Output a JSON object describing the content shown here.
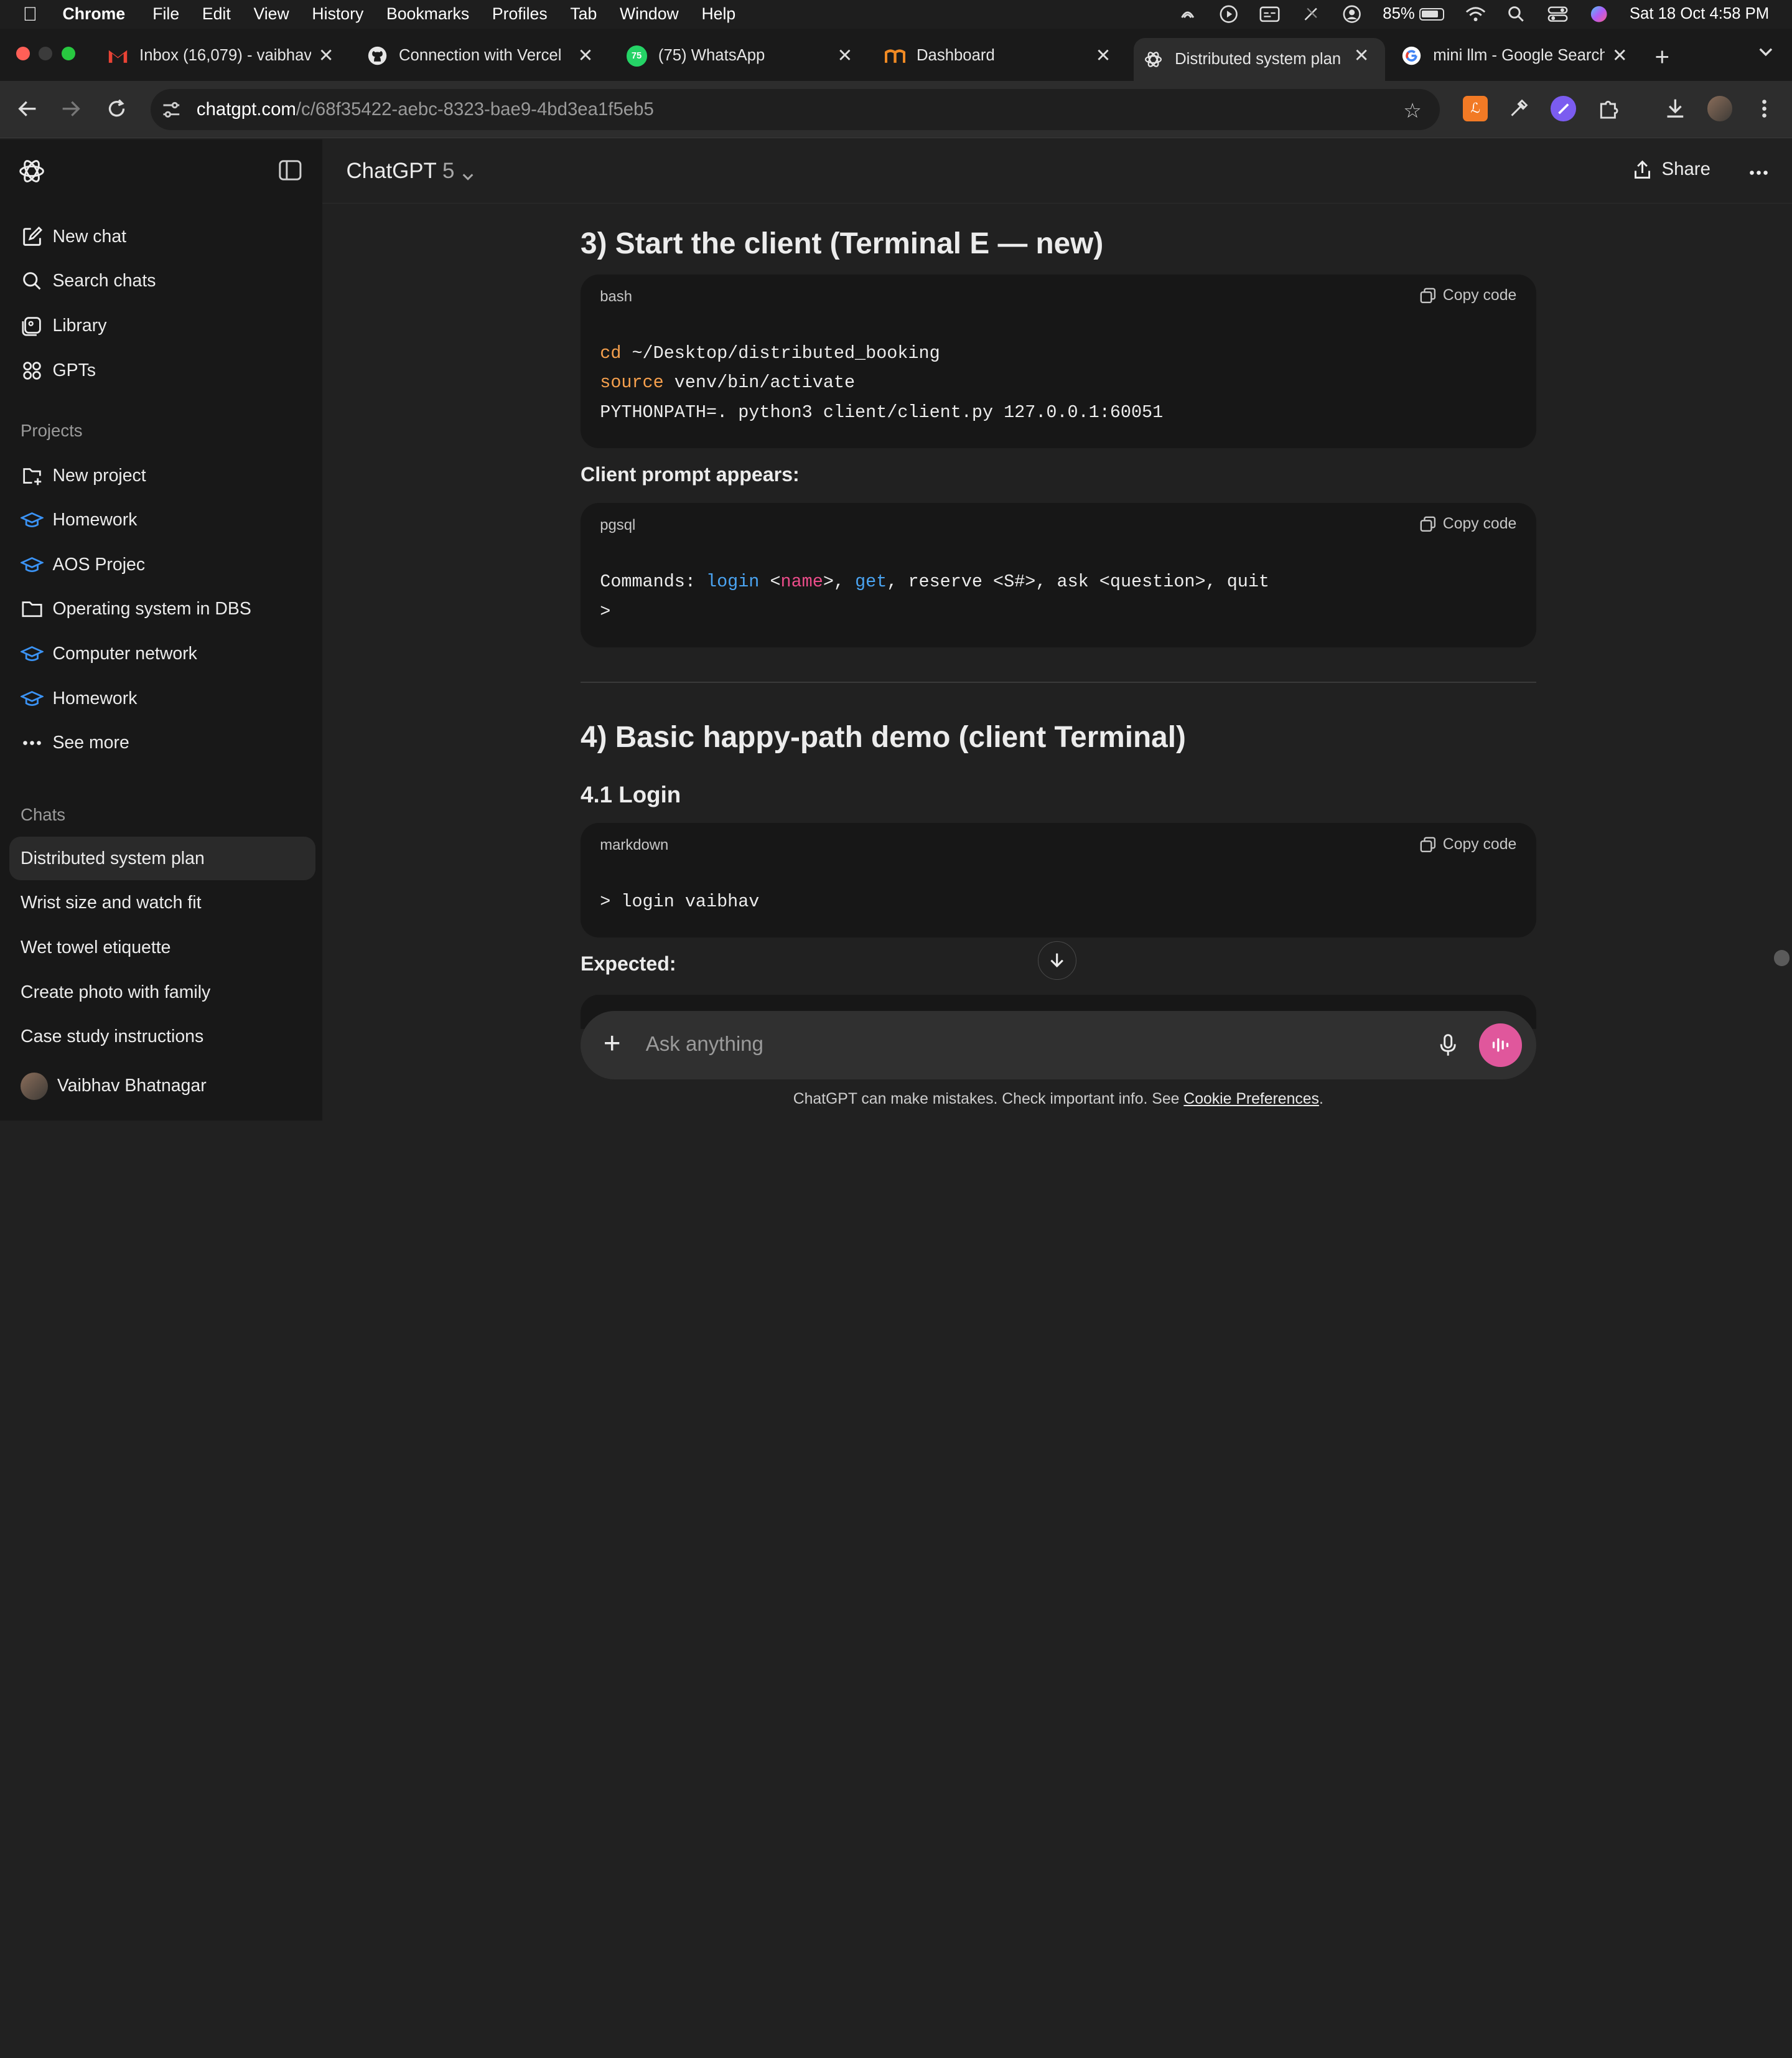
{
  "menubar": {
    "items": [
      "Chrome",
      "File",
      "Edit",
      "View",
      "History",
      "Bookmarks",
      "Profiles",
      "Tab",
      "Window",
      "Help"
    ],
    "battery": "85%",
    "datetime": "Sat 18 Oct  4:58 PM"
  },
  "tabs": [
    {
      "title": "Inbox (16,079) - vaibhav",
      "icon": "gmail-icon"
    },
    {
      "title": "Connection with Vercel",
      "icon": "github-icon"
    },
    {
      "title": "(75) WhatsApp",
      "icon": "whatsapp-icon",
      "badge": "75"
    },
    {
      "title": "Dashboard",
      "icon": "dashboard-icon"
    },
    {
      "title": "Distributed system plan",
      "icon": "chatgpt-icon"
    },
    {
      "title": "mini llm - Google Search",
      "icon": "google-icon"
    }
  ],
  "address": {
    "domain": "chatgpt.com",
    "path": "/c/68f35422-aebc-8323-bae9-4bd3ea1f5eb5"
  },
  "sidebar": {
    "top_items": [
      {
        "label": "New chat",
        "icon": "compose-icon"
      },
      {
        "label": "Search chats",
        "icon": "search-icon"
      },
      {
        "label": "Library",
        "icon": "library-icon"
      },
      {
        "label": "GPTs",
        "icon": "grid-icon"
      }
    ],
    "projects_heading": "Projects",
    "projects": [
      {
        "label": "New project",
        "icon": "folder-plus-icon"
      },
      {
        "label": "Homework",
        "icon": "graduation-cap-icon"
      },
      {
        "label": "AOS Projec",
        "icon": "graduation-cap-icon"
      },
      {
        "label": "Operating system in DBS",
        "icon": "folder-icon"
      },
      {
        "label": "Computer network",
        "icon": "graduation-cap-icon"
      },
      {
        "label": "Homework",
        "icon": "graduation-cap-icon"
      },
      {
        "label": "See more",
        "icon": "more-icon"
      }
    ],
    "chats_heading": "Chats",
    "chats": [
      "Distributed system plan",
      "Wrist size and watch fit",
      "Wet towel etiquette",
      "Create photo with family",
      "Case study instructions"
    ],
    "user_name": "Vaibhav Bhatnagar"
  },
  "header": {
    "model": "ChatGPT",
    "version": "5",
    "share": "Share"
  },
  "content": {
    "section3_title": "3) Start the client (Terminal E — new)",
    "block1": {
      "lang": "bash",
      "copy": "Copy code",
      "line1_kw": "cd",
      "line1_rest": " ~/Desktop/distributed_booking",
      "line2_kw": "source",
      "line2_rest": " venv/bin/activate",
      "line3": "PYTHONPATH=. python3 client/client.py 127.0.0.1:60051"
    },
    "client_prompt_label": "Client prompt appears:",
    "block2": {
      "lang": "pgsql",
      "copy": "Copy code",
      "p1": "Commands: ",
      "p2": "login",
      "p3": " <",
      "p4": "name",
      "p5": ">, ",
      "p6": "get",
      "p7": ", reserve <S#>, ask <question>, quit",
      "line2": ">"
    },
    "section4_title": "4) Basic happy-path demo (client Terminal)",
    "sub41": "4.1 Login",
    "block3": {
      "lang": "markdown",
      "copy": "Copy code",
      "line1": "> login vaibhav"
    },
    "expected_label": "Expected:"
  },
  "composer": {
    "placeholder": "Ask anything"
  },
  "disclaimer": {
    "text": "ChatGPT can make mistakes. Check important info. See ",
    "link": "Cookie Preferences",
    "end": "."
  }
}
